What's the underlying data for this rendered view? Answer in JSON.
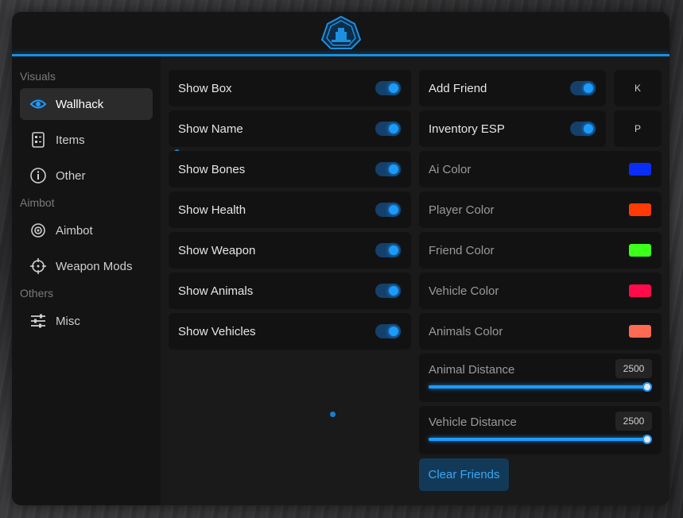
{
  "sidebar": {
    "groups": [
      {
        "title": "Visuals",
        "items": [
          {
            "label": "Wallhack",
            "icon": "eye-icon",
            "active": true
          },
          {
            "label": "Items",
            "icon": "checklist-icon"
          },
          {
            "label": "Other",
            "icon": "info-icon"
          }
        ]
      },
      {
        "title": "Aimbot",
        "items": [
          {
            "label": "Aimbot",
            "icon": "target-icon"
          },
          {
            "label": "Weapon Mods",
            "icon": "crosshair-icon"
          }
        ]
      },
      {
        "title": "Others",
        "items": [
          {
            "label": "Misc",
            "icon": "sliders-icon"
          }
        ]
      }
    ]
  },
  "left_toggles": [
    {
      "label": "Show Box",
      "on": true
    },
    {
      "label": "Show Name",
      "on": true
    },
    {
      "label": "Show Bones",
      "on": true
    },
    {
      "label": "Show Health",
      "on": true
    },
    {
      "label": "Show Weapon",
      "on": true
    },
    {
      "label": "Show Animals",
      "on": true
    },
    {
      "label": "Show Vehicles",
      "on": true
    }
  ],
  "right_toggles": [
    {
      "label": "Add Friend",
      "on": true,
      "key": "K"
    },
    {
      "label": "Inventory ESP",
      "on": true,
      "key": "P"
    }
  ],
  "colors": [
    {
      "label": "Ai Color",
      "color": "#0a2ef5"
    },
    {
      "label": "Player Color",
      "color": "#ff3a05"
    },
    {
      "label": "Friend Color",
      "color": "#3cff1a"
    },
    {
      "label": "Vehicle Color",
      "color": "#ff0a4a"
    },
    {
      "label": "Animals Color",
      "color": "#ff6a50"
    }
  ],
  "sliders": [
    {
      "label": "Animal Distance",
      "value": "2500",
      "fraction": 1.0
    },
    {
      "label": "Vehicle Distance",
      "value": "2500",
      "fraction": 1.0
    }
  ],
  "clear_button": "Clear Friends",
  "accent": "#1c9bff"
}
